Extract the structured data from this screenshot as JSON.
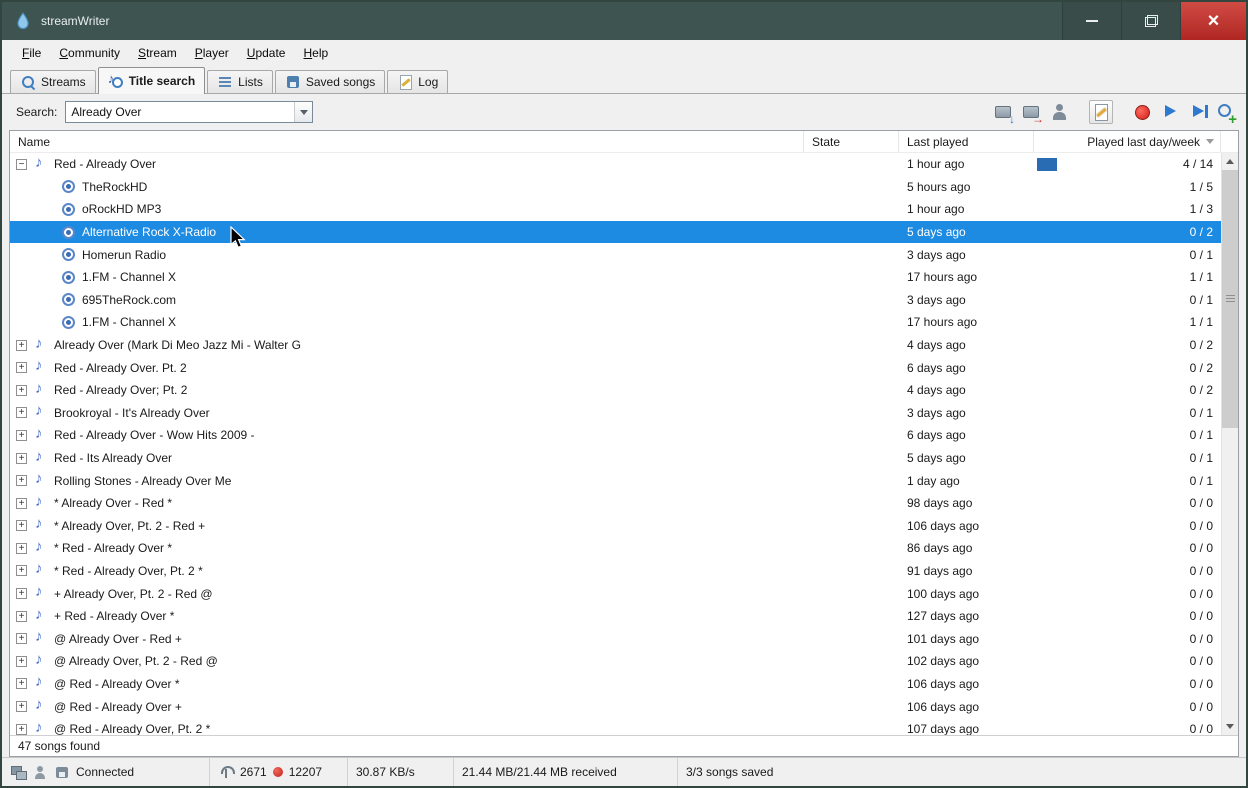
{
  "window": {
    "title": "streamWriter",
    "controls": [
      "minimize",
      "maximize",
      "close"
    ]
  },
  "menu": {
    "items": [
      "File",
      "Community",
      "Stream",
      "Player",
      "Update",
      "Help"
    ]
  },
  "tabs": [
    {
      "label": "Streams",
      "icon": "streams",
      "active": false
    },
    {
      "label": "Title search",
      "icon": "title-search",
      "active": true
    },
    {
      "label": "Lists",
      "icon": "lists",
      "active": false
    },
    {
      "label": "Saved songs",
      "icon": "saved-songs",
      "active": false
    },
    {
      "label": "Log",
      "icon": "log",
      "active": false
    }
  ],
  "search": {
    "label": "Search:",
    "value": "Already Over"
  },
  "toolbar": {
    "buttons": [
      {
        "name": "save-stream-button",
        "kind": "device-down"
      },
      {
        "name": "tuner-stream-button",
        "kind": "device-right"
      },
      {
        "name": "user-record-button",
        "kind": "user"
      },
      {
        "name": "edit-page-button",
        "kind": "page-edit",
        "raised": true,
        "gap_before": true
      },
      {
        "name": "record-button",
        "kind": "record",
        "gap_before": true
      },
      {
        "name": "play-button",
        "kind": "play"
      },
      {
        "name": "resume-button",
        "kind": "play-next"
      },
      {
        "name": "new-search-button",
        "kind": "search-plus"
      }
    ]
  },
  "table": {
    "columns": [
      {
        "label": "Name"
      },
      {
        "label": "State"
      },
      {
        "label": "Last played"
      },
      {
        "label": "Played last day/week",
        "sort": "desc"
      }
    ],
    "rows": [
      {
        "type": "parent",
        "expander": "minus",
        "name": "Red - Already Over",
        "last_played": "1 hour ago",
        "played": "4 / 14",
        "bar": true
      },
      {
        "type": "child",
        "name": "TheRockHD",
        "last_played": "5 hours ago",
        "played": "1 / 5"
      },
      {
        "type": "child",
        "name": "oRockHD MP3",
        "last_played": "1 hour ago",
        "played": "1 / 3"
      },
      {
        "type": "child",
        "name": "Alternative Rock X-Radio",
        "last_played": "5 days ago",
        "played": "0 / 2",
        "selected": true
      },
      {
        "type": "child",
        "name": "Homerun Radio",
        "last_played": "3 days ago",
        "played": "0 / 1"
      },
      {
        "type": "child",
        "name": "1.FM - Channel X",
        "last_played": "17 hours ago",
        "played": "1 / 1"
      },
      {
        "type": "child",
        "name": "695TheRock.com",
        "last_played": "3 days ago",
        "played": "0 / 1"
      },
      {
        "type": "child",
        "name": "1.FM - Channel X",
        "last_played": "17 hours ago",
        "played": "1 / 1"
      },
      {
        "type": "parent",
        "expander": "plus",
        "name": "Already Over (Mark Di Meo Jazz Mi - Walter G",
        "last_played": "4 days ago",
        "played": "0 / 2"
      },
      {
        "type": "parent",
        "expander": "plus",
        "name": "Red - Already Over. Pt. 2",
        "last_played": "6 days ago",
        "played": "0 / 2"
      },
      {
        "type": "parent",
        "expander": "plus",
        "name": "Red - Already Over; Pt. 2",
        "last_played": "4 days ago",
        "played": "0 / 2"
      },
      {
        "type": "parent",
        "expander": "plus",
        "name": "Brookroyal - It's Already Over",
        "last_played": "3 days ago",
        "played": "0 / 1"
      },
      {
        "type": "parent",
        "expander": "plus",
        "name": "Red - Already Over - Wow Hits 2009 -",
        "last_played": "6 days ago",
        "played": "0 / 1"
      },
      {
        "type": "parent",
        "expander": "plus",
        "name": "Red - Its Already Over",
        "last_played": "5 days ago",
        "played": "0 / 1"
      },
      {
        "type": "parent",
        "expander": "plus",
        "name": "Rolling Stones - Already Over Me",
        "last_played": "1 day ago",
        "played": "0 / 1"
      },
      {
        "type": "parent",
        "expander": "plus",
        "name": "* Already Over - Red *",
        "last_played": "98 days ago",
        "played": "0 / 0"
      },
      {
        "type": "parent",
        "expander": "plus",
        "name": "* Already Over, Pt. 2 - Red +",
        "last_played": "106 days ago",
        "played": "0 / 0"
      },
      {
        "type": "parent",
        "expander": "plus",
        "name": "* Red - Already Over *",
        "last_played": "86 days ago",
        "played": "0 / 0"
      },
      {
        "type": "parent",
        "expander": "plus",
        "name": "* Red - Already Over, Pt. 2 *",
        "last_played": "91 days ago",
        "played": "0 / 0"
      },
      {
        "type": "parent",
        "expander": "plus",
        "name": "+ Already Over, Pt. 2 - Red @",
        "last_played": "100 days ago",
        "played": "0 / 0"
      },
      {
        "type": "parent",
        "expander": "plus",
        "name": "+ Red - Already Over *",
        "last_played": "127 days ago",
        "played": "0 / 0"
      },
      {
        "type": "parent",
        "expander": "plus",
        "name": "@ Already Over - Red +",
        "last_played": "101 days ago",
        "played": "0 / 0"
      },
      {
        "type": "parent",
        "expander": "plus",
        "name": "@ Already Over, Pt. 2 - Red @",
        "last_played": "102 days ago",
        "played": "0 / 0"
      },
      {
        "type": "parent",
        "expander": "plus",
        "name": "@ Red - Already Over *",
        "last_played": "106 days ago",
        "played": "0 / 0"
      },
      {
        "type": "parent",
        "expander": "plus",
        "name": "@ Red - Already Over +",
        "last_played": "106 days ago",
        "played": "0 / 0"
      },
      {
        "type": "parent",
        "expander": "plus",
        "name": "@ Red - Already Over, Pt. 2 *",
        "last_played": "107 days ago",
        "played": "0 / 0"
      }
    ]
  },
  "footer": {
    "found": "47 songs found"
  },
  "statusbar": {
    "connected": "Connected",
    "streams_count": "2671",
    "titles_count": "12207",
    "speed": "30.87 KB/s",
    "received": "21.44 MB/21.44 MB received",
    "songs_saved": "3/3 songs saved"
  },
  "colors": {
    "titlebar": "#3e5451",
    "close_button": "#c23430",
    "selection": "#1e8be2",
    "played_bar": "#2a6cb3",
    "accent_blue": "#2c79cf"
  }
}
